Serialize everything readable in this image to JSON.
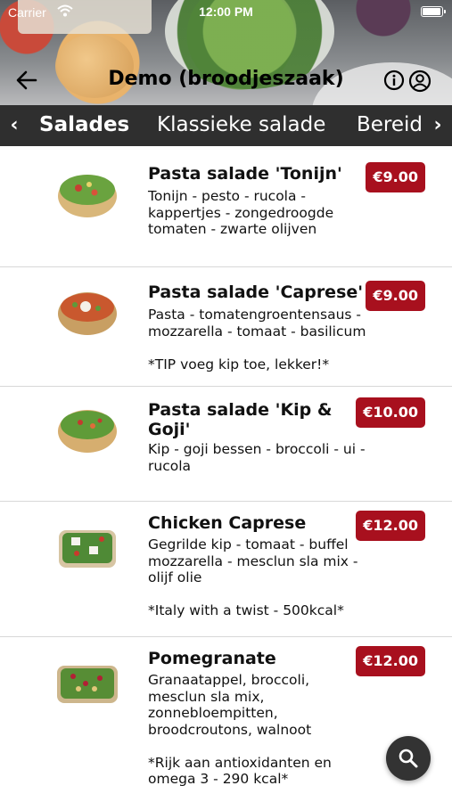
{
  "status_bar": {
    "carrier": "Carrier",
    "time": "12:00 PM",
    "battery_level": 1.0
  },
  "header": {
    "title": "Demo (broodjeszaak)"
  },
  "icons": {
    "back": "back-arrow-icon",
    "info": "info-icon",
    "account": "user-icon",
    "search": "search-icon"
  },
  "tabs": [
    {
      "label": "Salades",
      "active": true
    },
    {
      "label": "Klassieke salade",
      "active": false
    },
    {
      "label": "Bereid",
      "active": false
    }
  ],
  "colors": {
    "price_bg": "#a8101e",
    "tabs_bg": "#2f2f2f",
    "fab_bg": "#333333"
  },
  "menu": [
    {
      "name": "Pasta salade 'Tonijn'",
      "description": "Tonijn - pesto - rucola -\nkappertjes - zongedroogde\ntomaten - zwarte olijven",
      "price": "€9.00"
    },
    {
      "name": "Pasta salade 'Caprese'",
      "description": "Pasta - tomatengroentensaus -\nmozzarella - tomaat - basilicum\n\n*TIP voeg kip toe, lekker!*",
      "price": "€9.00"
    },
    {
      "name": "Pasta salade 'Kip &\nGoji'",
      "description": "Kip - goji bessen - broccoli - ui -\nrucola",
      "price": "€10.00"
    },
    {
      "name": "Chicken Caprese",
      "description": "Gegrilde kip - tomaat - buffel\nmozzarella - mesclun sla mix -\nolijf olie\n\n*Italy with a twist - 500kcal*",
      "price": "€12.00"
    },
    {
      "name": "Pomegranate",
      "description": "Granaatappel, broccoli,\nmesclun sla mix,\nzonnebloempitten,\nbroodcroutons, walnoot\n\n*Rijk aan antioxidanten en\nomega 3 - 290 kcal*",
      "price": "€12.00"
    }
  ]
}
